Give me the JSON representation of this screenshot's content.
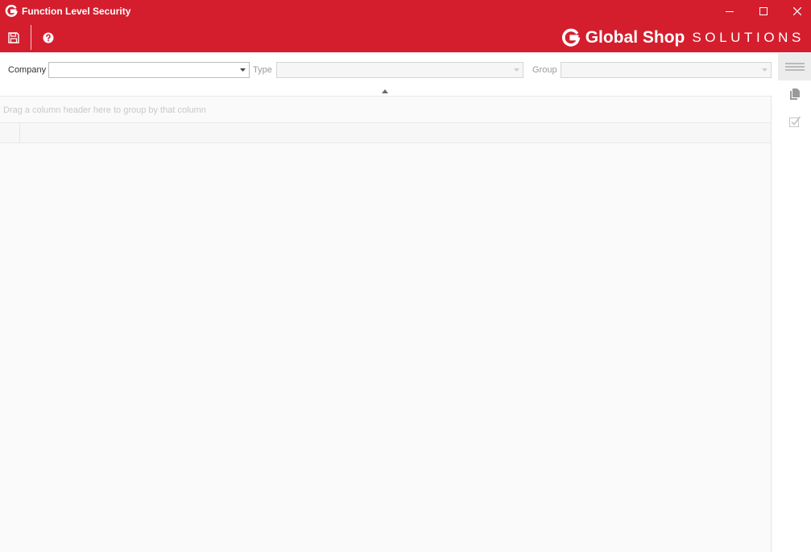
{
  "window": {
    "title": "Function Level Security",
    "app_icon": "globalshop-g-icon",
    "controls": [
      "minimize-icon",
      "maximize-icon",
      "close-icon"
    ]
  },
  "toolbar": {
    "buttons": [
      {
        "name": "save",
        "icon": "save-icon"
      },
      {
        "name": "help",
        "icon": "help-circle-icon"
      }
    ],
    "brand": {
      "name": "Global Shop",
      "sub": "SOLUTIONS",
      "icon": "globalshop-g-icon"
    }
  },
  "filters": {
    "company": {
      "label": "Company",
      "value": "",
      "enabled": true
    },
    "type": {
      "label": "Type",
      "value": "",
      "enabled": false
    },
    "group": {
      "label": "Group",
      "value": "",
      "enabled": false
    }
  },
  "grid": {
    "group_panel_hint": "Drag a column header here to group by that column",
    "columns": [],
    "rows": []
  },
  "side_panel": {
    "buttons": [
      {
        "name": "menu",
        "icon": "hamburger-menu-icon",
        "active": true
      },
      {
        "name": "copy",
        "icon": "copy-icon"
      },
      {
        "name": "check",
        "icon": "checkmark-icon"
      }
    ]
  },
  "colors": {
    "accent": "#d41e2d",
    "text": "#333333",
    "hint": "#c8c8c8",
    "background": "#fafafa"
  }
}
